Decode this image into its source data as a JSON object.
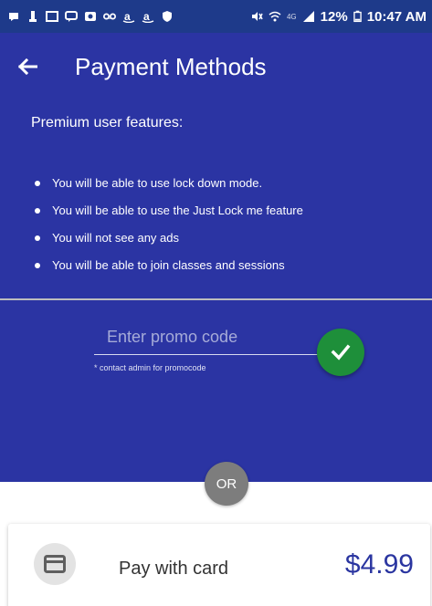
{
  "status_bar": {
    "time": "10:47 AM",
    "battery": "12%",
    "network": "4G",
    "left_icons": [
      "notification-icon",
      "usb-icon",
      "gallery-icon",
      "message-icon",
      "photo-icon",
      "voicemail-icon",
      "amazon-icon",
      "amazon-icon",
      "shield-icon"
    ],
    "right_icons": [
      "mute-icon",
      "wifi-icon",
      "signal-icon",
      "battery-icon"
    ]
  },
  "app_bar": {
    "back_icon": "arrow-left-icon",
    "title": "Payment Methods"
  },
  "features": {
    "title": "Premium user features:",
    "items": [
      "You will be able to use lock down mode.",
      "You will be able to use the Just Lock me feature",
      "You will not see any ads",
      "You will be able to join classes and sessions"
    ]
  },
  "promo": {
    "placeholder": "Enter promo code",
    "value": "",
    "hint": "* contact admin for promocode",
    "submit_icon": "checkmark-icon"
  },
  "divider_label": "OR",
  "payment_option": {
    "icon": "credit-card-icon",
    "label": "Pay with card",
    "price": "$4.99"
  },
  "colors": {
    "primary": "#2b34a3",
    "status_bar": "#1e3a8a",
    "success": "#1e8f3a",
    "or_badge": "#7d7d7d",
    "price_text": "#2a35a0"
  }
}
